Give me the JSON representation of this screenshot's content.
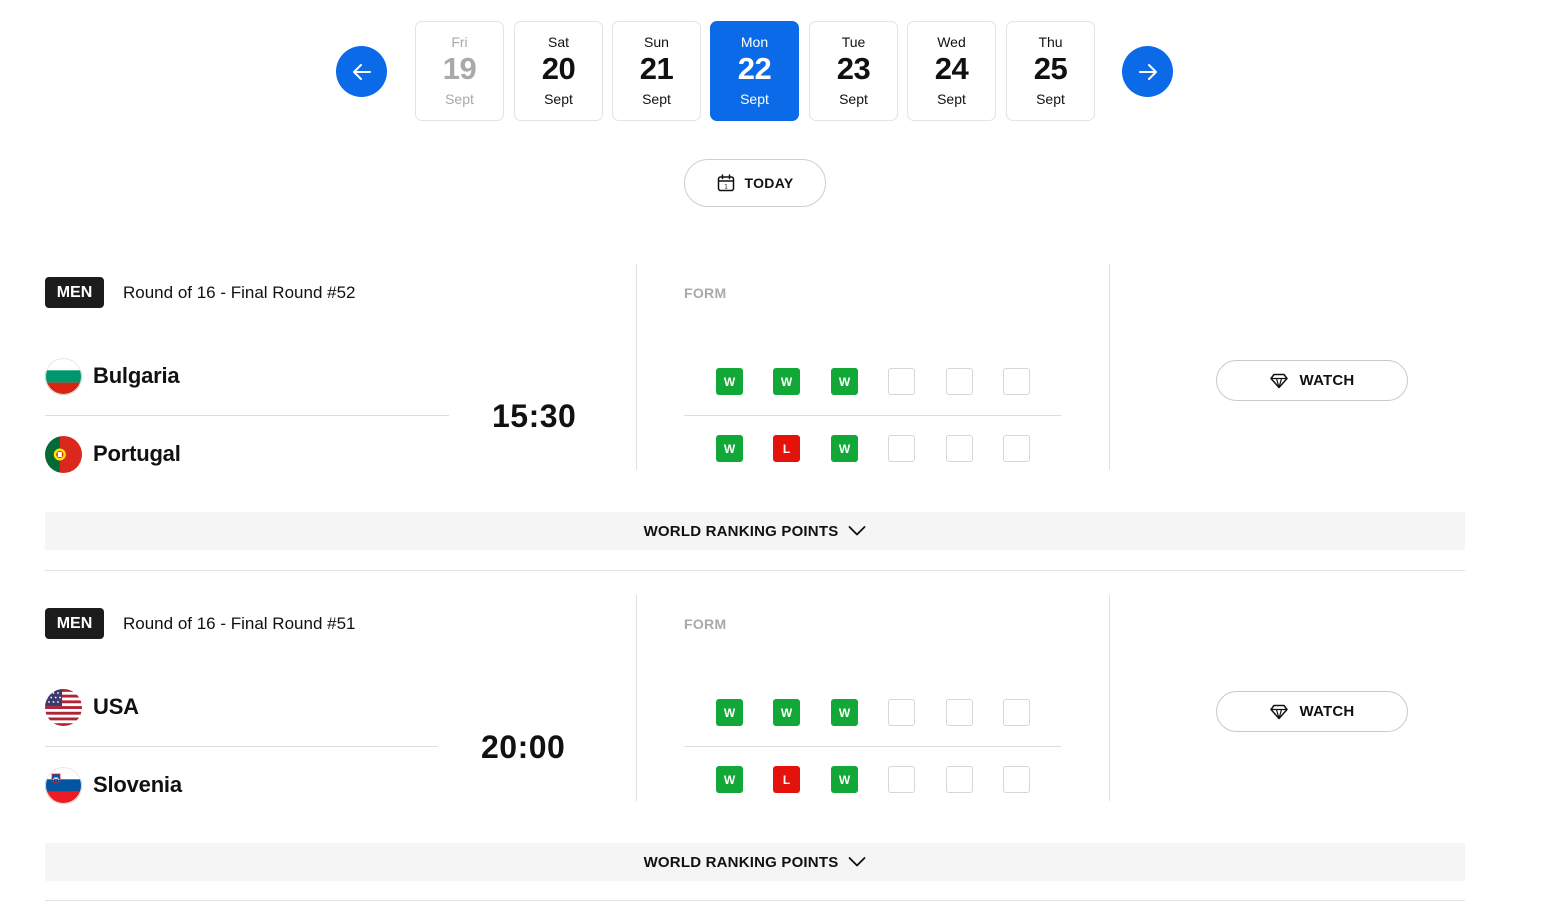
{
  "dates": {
    "days": [
      {
        "dow": "Fri",
        "num": "19",
        "month": "Sept",
        "state": "past"
      },
      {
        "dow": "Sat",
        "num": "20",
        "month": "Sept",
        "state": "normal"
      },
      {
        "dow": "Sun",
        "num": "21",
        "month": "Sept",
        "state": "normal"
      },
      {
        "dow": "Mon",
        "num": "22",
        "month": "Sept",
        "state": "active"
      },
      {
        "dow": "Tue",
        "num": "23",
        "month": "Sept",
        "state": "normal"
      },
      {
        "dow": "Wed",
        "num": "24",
        "month": "Sept",
        "state": "normal"
      },
      {
        "dow": "Thu",
        "num": "25",
        "month": "Sept",
        "state": "normal"
      }
    ]
  },
  "today_button": {
    "label": "TODAY"
  },
  "colors": {
    "accent": "#0a6ae8",
    "win": "#11a838",
    "loss": "#e3120b"
  },
  "matches": [
    {
      "gender": "MEN",
      "round": "Round of 16 - Final Round #52",
      "time": "15:30",
      "form_label": "FORM",
      "teams": [
        {
          "name": "Bulgaria",
          "flag": "bulgaria-flag-icon",
          "form": [
            "W",
            "W",
            "W",
            "",
            "",
            ""
          ]
        },
        {
          "name": "Portugal",
          "flag": "portugal-flag-icon",
          "form": [
            "W",
            "L",
            "W",
            "",
            "",
            ""
          ]
        }
      ],
      "watch_label": "WATCH",
      "ranking_label": "WORLD RANKING POINTS"
    },
    {
      "gender": "MEN",
      "round": "Round of 16 - Final Round #51",
      "time": "20:00",
      "form_label": "FORM",
      "teams": [
        {
          "name": "USA",
          "flag": "usa-flag-icon",
          "form": [
            "W",
            "W",
            "W",
            "",
            "",
            ""
          ]
        },
        {
          "name": "Slovenia",
          "flag": "slovenia-flag-icon",
          "form": [
            "W",
            "L",
            "W",
            "",
            "",
            ""
          ]
        }
      ],
      "watch_label": "WATCH",
      "ranking_label": "WORLD RANKING POINTS"
    }
  ]
}
